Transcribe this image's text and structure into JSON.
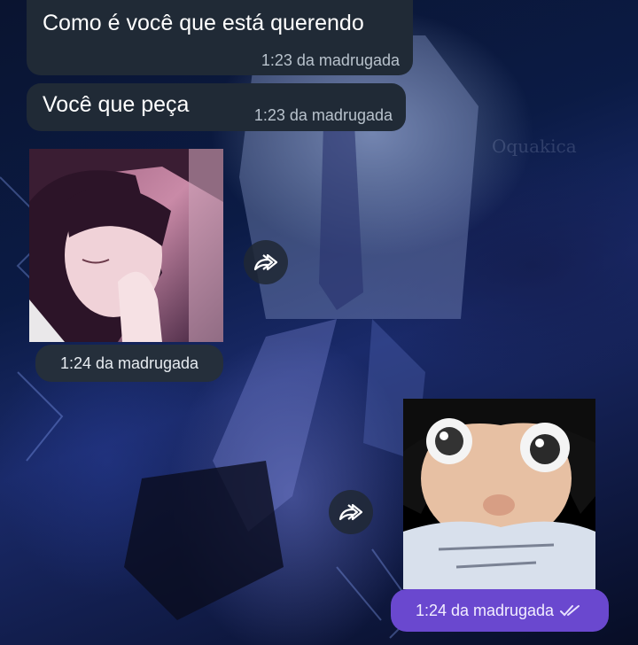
{
  "messages": [
    {
      "text": "Como é você que está querendo",
      "time": "1:23 da madrugada"
    },
    {
      "text": "Você que peça",
      "time": "1:23 da madrugada"
    }
  ],
  "media": [
    {
      "time": "1:24 da madrugada",
      "icon": "forward-icon"
    },
    {
      "time": "1:24 da madrugada",
      "icon": "forward-icon",
      "status_icon": "double-check-icon"
    }
  ],
  "wallpaper_watermark": "Oquakica",
  "colors": {
    "incoming_bubble": "#202a36",
    "outgoing_pill": "#6a48cf",
    "timestamp": "#b8c2cc"
  }
}
